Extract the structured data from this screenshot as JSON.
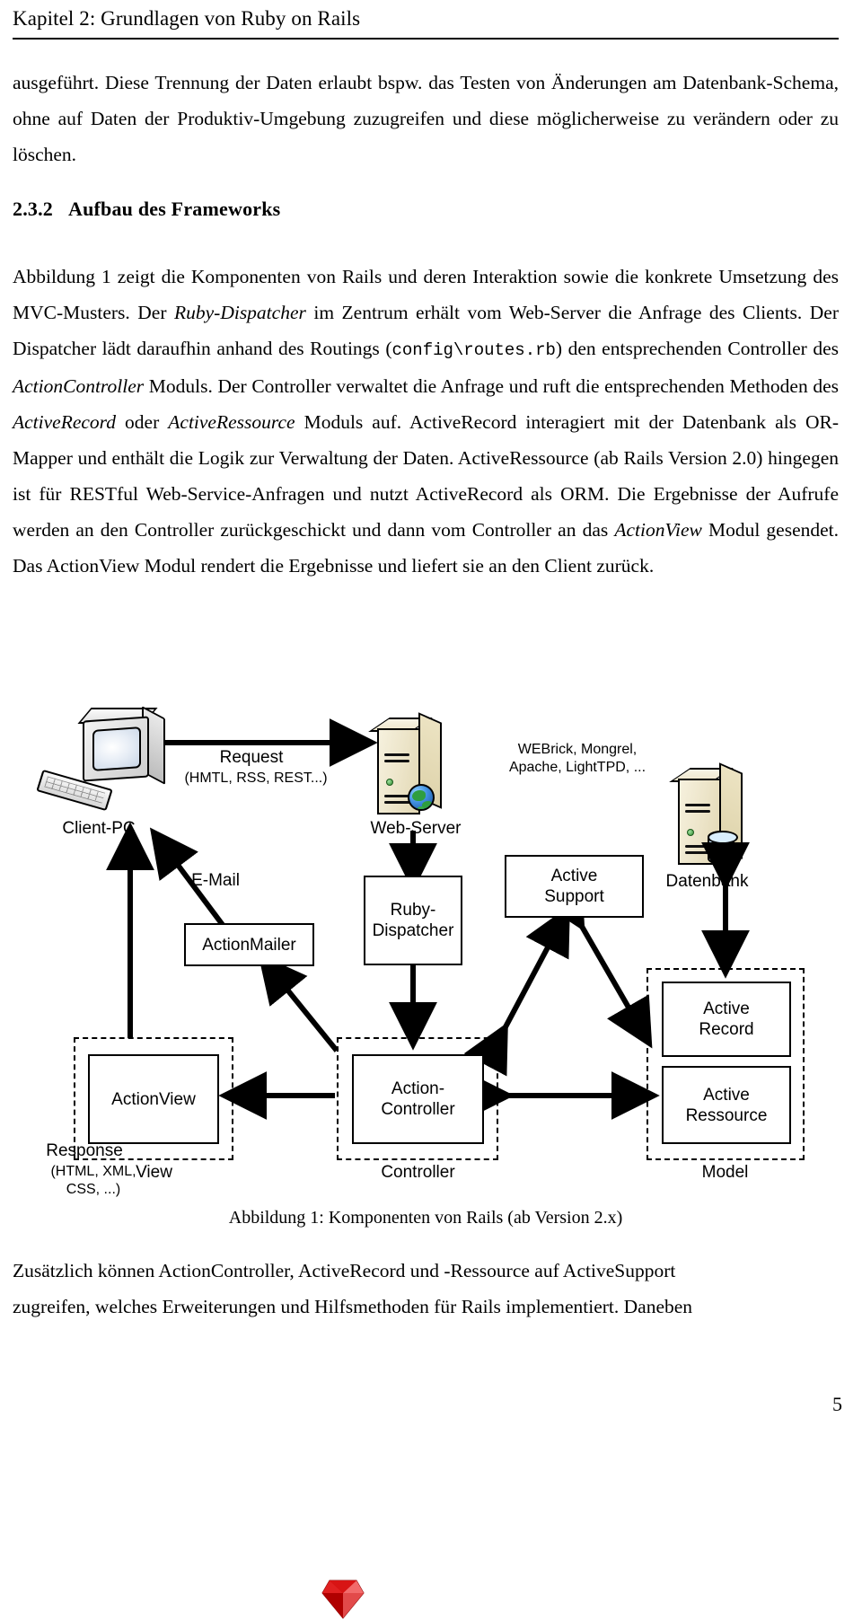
{
  "header": {
    "running_head": "Kapitel 2: Grundlagen von Ruby on Rails"
  },
  "paragraphs": {
    "intro": "ausgeführt. Diese Trennung der Daten erlaubt bspw. das Testen von Änderungen am Datenbank-Schema, ohne auf Daten der Produktiv-Umgebung zuzugreifen und diese möglicherweise zu verändern oder zu löschen.",
    "after_figure_1": "Zusätzlich können ActionController, ActiveRecord und -Ressource auf ActiveSupport",
    "after_figure_2": "zugreifen, welches Erweiterungen und Hilfsmethoden für Rails implementiert. Daneben"
  },
  "section": {
    "number": "2.3.2",
    "title": "Aufbau des Frameworks"
  },
  "main_text": {
    "s1": "Abbildung 1 zeigt die Komponenten von Rails und deren Interaktion sowie die konkrete Umsetzung des MVC-Musters. Der ",
    "em1": "Ruby-Dispatcher",
    "s2": " im Zentrum erhält vom Web-Server die Anfrage des Clients. Der Dispatcher lädt daraufhin anhand des Routings (",
    "code1": "config\\routes.rb",
    "s3": ") den entsprechenden Controller des ",
    "em2": "ActionController",
    "s4": " Moduls. Der Controller verwaltet die Anfrage und ruft die entsprechenden Methoden des ",
    "em3": "ActiveRecord",
    "s5": " oder ",
    "em4": "ActiveRessource",
    "s6": " Moduls auf. ActiveRecord interagiert mit der Datenbank als OR-Mapper und enthält die Logik zur Verwaltung der Daten. ActiveRessource (ab Rails Version 2.0) hingegen ist für RESTful Web-Service-Anfragen und nutzt ActiveRecord als ORM. Die Ergebnisse der Aufrufe werden an den Controller zurückgeschickt und dann vom Controller an das ",
    "em5": "ActionView",
    "s7": " Modul gesendet. Das ActionView Modul rendert die Ergebnisse und liefert sie an den Client zurück."
  },
  "figure": {
    "caption": "Abbildung 1: Komponenten von Rails (ab Version 2.x)",
    "nodes": {
      "client_pc": "Client-PC",
      "web_server": "Web-Server",
      "datenbank": "Datenbank",
      "action_mailer": "ActionMailer",
      "ruby_dispatcher_line1": "Ruby-",
      "ruby_dispatcher_line2": "Dispatcher",
      "active_support_line1": "Active",
      "active_support_line2": "Support",
      "action_view": "ActionView",
      "action_controller_line1": "Action-",
      "action_controller_line2": "Controller",
      "active_record_line1": "Active",
      "active_record_line2": "Record",
      "active_ressource_line1": "Active",
      "active_ressource_line2": "Ressource"
    },
    "group_labels": {
      "view": "View",
      "controller": "Controller",
      "model": "Model"
    },
    "edge_labels": {
      "request_line1": "Request",
      "request_line2": "(HMTL, RSS, REST...)",
      "response_line1": "Response",
      "response_line2": "(HTML, XML,",
      "response_line3": "CSS, ...)",
      "email": "E-Mail"
    },
    "annotations": {
      "webserver_impls_line1": "WEBrick, Mongrel,",
      "webserver_impls_line2": "Apache, LightTPD, ..."
    }
  },
  "footer": {
    "page_number": "5"
  }
}
